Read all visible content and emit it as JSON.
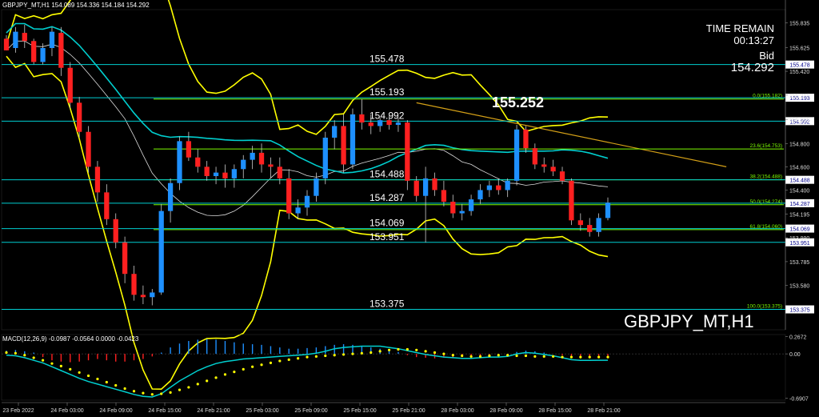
{
  "header": {
    "title": "GBPJPY_MT,H1  154.089 154.336 154.184 154.292"
  },
  "info": {
    "time_remain_label": "TIME REMAIN",
    "time_remain_value": "00:13:27",
    "bid_label": "Bid",
    "bid_value": "154.292",
    "watermark": "GBPJPY_MT,H1",
    "highlight_price": "155.252"
  },
  "chart_data": [
    {
      "type": "candlestick",
      "symbol": "GBPJPY_MT",
      "timeframe": "H1",
      "ohlc_header": {
        "open": 154.089,
        "high": 154.336,
        "low": 154.184,
        "close": 154.292
      },
      "ylim": [
        153.2,
        155.95
      ],
      "y_ticks": [
        155.835,
        155.625,
        155.42,
        155.215,
        155.005,
        154.8,
        154.6,
        154.4,
        154.195,
        153.99,
        153.785,
        153.58
      ],
      "x_ticks": [
        "23 Feb 2022",
        "24 Feb 03:00",
        "24 Feb 09:00",
        "24 Feb 15:00",
        "24 Feb 21:00",
        "25 Feb 03:00",
        "25 Feb 09:00",
        "25 Feb 15:00",
        "25 Feb 21:00",
        "28 Feb 03:00",
        "28 Feb 09:00",
        "28 Feb 15:00",
        "28 Feb 21:00"
      ],
      "candles": [
        [
          155.7,
          155.73,
          155.6,
          155.6
        ],
        [
          155.62,
          155.8,
          155.58,
          155.76
        ],
        [
          155.75,
          155.82,
          155.62,
          155.68
        ],
        [
          155.68,
          155.7,
          155.48,
          155.5
        ],
        [
          155.5,
          155.66,
          155.48,
          155.62
        ],
        [
          155.62,
          155.8,
          155.55,
          155.76
        ],
        [
          155.75,
          155.8,
          155.38,
          155.45
        ],
        [
          155.45,
          155.5,
          155.1,
          155.15
        ],
        [
          155.15,
          155.2,
          154.85,
          154.9
        ],
        [
          154.9,
          154.95,
          154.55,
          154.6
        ],
        [
          154.6,
          154.65,
          154.3,
          154.38
        ],
        [
          154.38,
          154.45,
          154.1,
          154.15
        ],
        [
          154.15,
          154.2,
          153.9,
          153.95
        ],
        [
          153.95,
          154.0,
          153.6,
          153.68
        ],
        [
          153.68,
          153.75,
          153.45,
          153.5
        ],
        [
          153.5,
          153.58,
          153.42,
          153.48
        ],
        [
          153.48,
          153.55,
          153.41,
          153.52
        ],
        [
          153.52,
          154.28,
          153.5,
          154.22
        ],
        [
          154.22,
          154.5,
          154.12,
          154.46
        ],
        [
          154.46,
          154.86,
          154.4,
          154.82
        ],
        [
          154.82,
          154.9,
          154.65,
          154.68
        ],
        [
          154.68,
          154.75,
          154.55,
          154.6
        ],
        [
          154.6,
          154.65,
          154.48,
          154.52
        ],
        [
          154.52,
          154.6,
          154.45,
          154.55
        ],
        [
          154.55,
          154.62,
          154.42,
          154.5
        ],
        [
          154.5,
          154.62,
          154.42,
          154.58
        ],
        [
          154.58,
          154.7,
          154.5,
          154.66
        ],
        [
          154.66,
          154.78,
          154.58,
          154.72
        ],
        [
          154.72,
          154.8,
          154.55,
          154.62
        ],
        [
          154.62,
          154.68,
          154.5,
          154.6
        ],
        [
          154.6,
          154.68,
          154.45,
          154.5
        ],
        [
          154.5,
          154.58,
          154.15,
          154.2
        ],
        [
          154.2,
          154.32,
          154.15,
          154.25
        ],
        [
          154.25,
          154.4,
          154.18,
          154.35
        ],
        [
          154.35,
          154.55,
          154.3,
          154.5
        ],
        [
          154.5,
          154.9,
          154.45,
          154.85
        ],
        [
          154.85,
          155.0,
          154.75,
          154.95
        ],
        [
          154.95,
          155.05,
          154.55,
          154.62
        ],
        [
          154.62,
          155.1,
          154.58,
          155.05
        ],
        [
          155.05,
          155.18,
          154.92,
          154.98
        ],
        [
          154.98,
          155.05,
          154.88,
          154.95
        ],
        [
          154.95,
          155.02,
          154.9,
          155.0
        ],
        [
          155.0,
          155.05,
          154.92,
          154.96
        ],
        [
          154.96,
          155.02,
          154.9,
          154.98
        ],
        [
          154.98,
          155.0,
          154.4,
          154.48
        ],
        [
          154.48,
          154.52,
          154.3,
          154.35
        ],
        [
          154.35,
          154.6,
          153.95,
          154.5
        ],
        [
          154.5,
          154.55,
          154.35,
          154.4
        ],
        [
          154.4,
          154.48,
          154.26,
          154.3
        ],
        [
          154.3,
          154.36,
          154.16,
          154.2
        ],
        [
          154.2,
          154.28,
          154.14,
          154.22
        ],
        [
          154.22,
          154.36,
          154.18,
          154.32
        ],
        [
          154.32,
          154.45,
          154.28,
          154.4
        ],
        [
          154.4,
          154.48,
          154.34,
          154.44
        ],
        [
          154.44,
          154.5,
          154.36,
          154.4
        ],
        [
          154.4,
          154.5,
          154.34,
          154.48
        ],
        [
          154.48,
          154.96,
          154.44,
          154.92
        ],
        [
          154.92,
          154.95,
          154.72,
          154.76
        ],
        [
          154.76,
          154.8,
          154.58,
          154.62
        ],
        [
          154.62,
          154.68,
          154.55,
          154.6
        ],
        [
          154.6,
          154.66,
          154.52,
          154.56
        ],
        [
          154.56,
          154.6,
          154.45,
          154.48
        ],
        [
          154.48,
          154.5,
          154.1,
          154.14
        ],
        [
          154.14,
          154.2,
          154.05,
          154.1
        ],
        [
          154.1,
          154.16,
          154.0,
          154.04
        ],
        [
          154.04,
          154.2,
          154.0,
          154.16
        ],
        [
          154.16,
          154.336,
          154.14,
          154.292
        ]
      ],
      "levels": [
        {
          "label": "155.478",
          "value": 155.478
        },
        {
          "label": "155.193",
          "value": 155.193
        },
        {
          "label": "154.992",
          "value": 154.992
        },
        {
          "label": "154.488",
          "value": 154.488
        },
        {
          "label": "154.287",
          "value": 154.287
        },
        {
          "label": "154.069",
          "value": 154.069
        },
        {
          "label": "153.951",
          "value": 153.951
        },
        {
          "label": "153.375",
          "value": 153.375
        }
      ],
      "fibonacci": [
        {
          "label": "0.0(155.182)",
          "value": 155.182
        },
        {
          "label": "23.6(154.753)",
          "value": 154.753
        },
        {
          "label": "38.2(154.488)",
          "value": 154.488
        },
        {
          "label": "50.0(154.274)",
          "value": 154.274
        },
        {
          "label": "61.8(154.060)",
          "value": 154.06
        },
        {
          "label": "100.0(153.375)",
          "value": 153.375
        }
      ]
    },
    {
      "type": "bar",
      "title": "MACD(12,26,9) -0.0987 -0.0564 0.0000 -0.0423",
      "ylim": [
        -0.72,
        0.3
      ],
      "y_ticks": [
        0.2672,
        0.0,
        -0.6907
      ],
      "y_tick_labels": [
        "0.2672",
        "0.00",
        "-0.6907"
      ],
      "histogram": [
        0.05,
        0.06,
        0.04,
        0.02,
        -0.05,
        -0.1,
        -0.12,
        -0.13,
        -0.12,
        -0.1,
        -0.08,
        -0.1,
        -0.12,
        -0.12,
        -0.1,
        -0.08,
        -0.04,
        0.02,
        0.1,
        0.16,
        0.2,
        0.22,
        0.23,
        0.22,
        0.2,
        0.18,
        0.16,
        0.15,
        0.14,
        0.12,
        0.1,
        0.08,
        0.08,
        0.09,
        0.1,
        0.12,
        0.14,
        0.15,
        0.14,
        0.12,
        0.1,
        0.08,
        0.06,
        0.03,
        -0.02,
        -0.05,
        -0.06,
        -0.07,
        -0.06,
        -0.06,
        -0.05,
        -0.04,
        -0.03,
        -0.02,
        -0.02,
        -0.01,
        0.03,
        0.05,
        0.04,
        0.02,
        0.0,
        -0.02,
        -0.05,
        -0.07,
        -0.06,
        -0.05,
        -0.04
      ],
      "signal": [
        0.02,
        0.01,
        -0.02,
        -0.06,
        -0.1,
        -0.15,
        -0.19,
        -0.24,
        -0.29,
        -0.34,
        -0.39,
        -0.44,
        -0.49,
        -0.54,
        -0.58,
        -0.61,
        -0.63,
        -0.62,
        -0.6,
        -0.56,
        -0.52,
        -0.47,
        -0.42,
        -0.37,
        -0.32,
        -0.28,
        -0.24,
        -0.2,
        -0.17,
        -0.14,
        -0.11,
        -0.09,
        -0.07,
        -0.05,
        -0.04,
        -0.03,
        -0.02,
        -0.01,
        0.0,
        0.01,
        0.02,
        0.04,
        0.06,
        0.07,
        0.07,
        0.06,
        0.04,
        0.02,
        0.0,
        -0.02,
        -0.03,
        -0.04,
        -0.04,
        -0.03,
        -0.02,
        -0.02,
        -0.03,
        -0.03,
        -0.04,
        -0.04,
        -0.04,
        -0.05,
        -0.05,
        -0.05,
        -0.05,
        -0.05,
        -0.05
      ],
      "macd_line": [
        -0.02,
        -0.03,
        -0.06,
        -0.1,
        -0.14,
        -0.2,
        -0.26,
        -0.32,
        -0.38,
        -0.43,
        -0.47,
        -0.51,
        -0.55,
        -0.59,
        -0.63,
        -0.66,
        -0.67,
        -0.62,
        -0.52,
        -0.42,
        -0.34,
        -0.26,
        -0.2,
        -0.15,
        -0.12,
        -0.1,
        -0.08,
        -0.07,
        -0.06,
        -0.05,
        -0.04,
        -0.03,
        -0.02,
        -0.01,
        0.01,
        0.04,
        0.08,
        0.1,
        0.11,
        0.12,
        0.12,
        0.12,
        0.1,
        0.08,
        0.05,
        0.02,
        -0.01,
        -0.03,
        -0.05,
        -0.06,
        -0.07,
        -0.07,
        -0.06,
        -0.05,
        -0.05,
        -0.04,
        0.0,
        0.02,
        0.01,
        -0.01,
        -0.03,
        -0.06,
        -0.09,
        -0.1,
        -0.1,
        -0.099,
        -0.0987
      ]
    }
  ],
  "colors": {
    "background": "#000000",
    "bull": "#1e90ff",
    "bear": "#ff2020",
    "level": "#00ced1",
    "fib": "#7cfc00",
    "bollinger": "#ffff00",
    "ma": "#00cfcf",
    "trendline": "#d4a017",
    "signal": "#ffff00",
    "text": "#ffffff",
    "axis": "#888888"
  }
}
